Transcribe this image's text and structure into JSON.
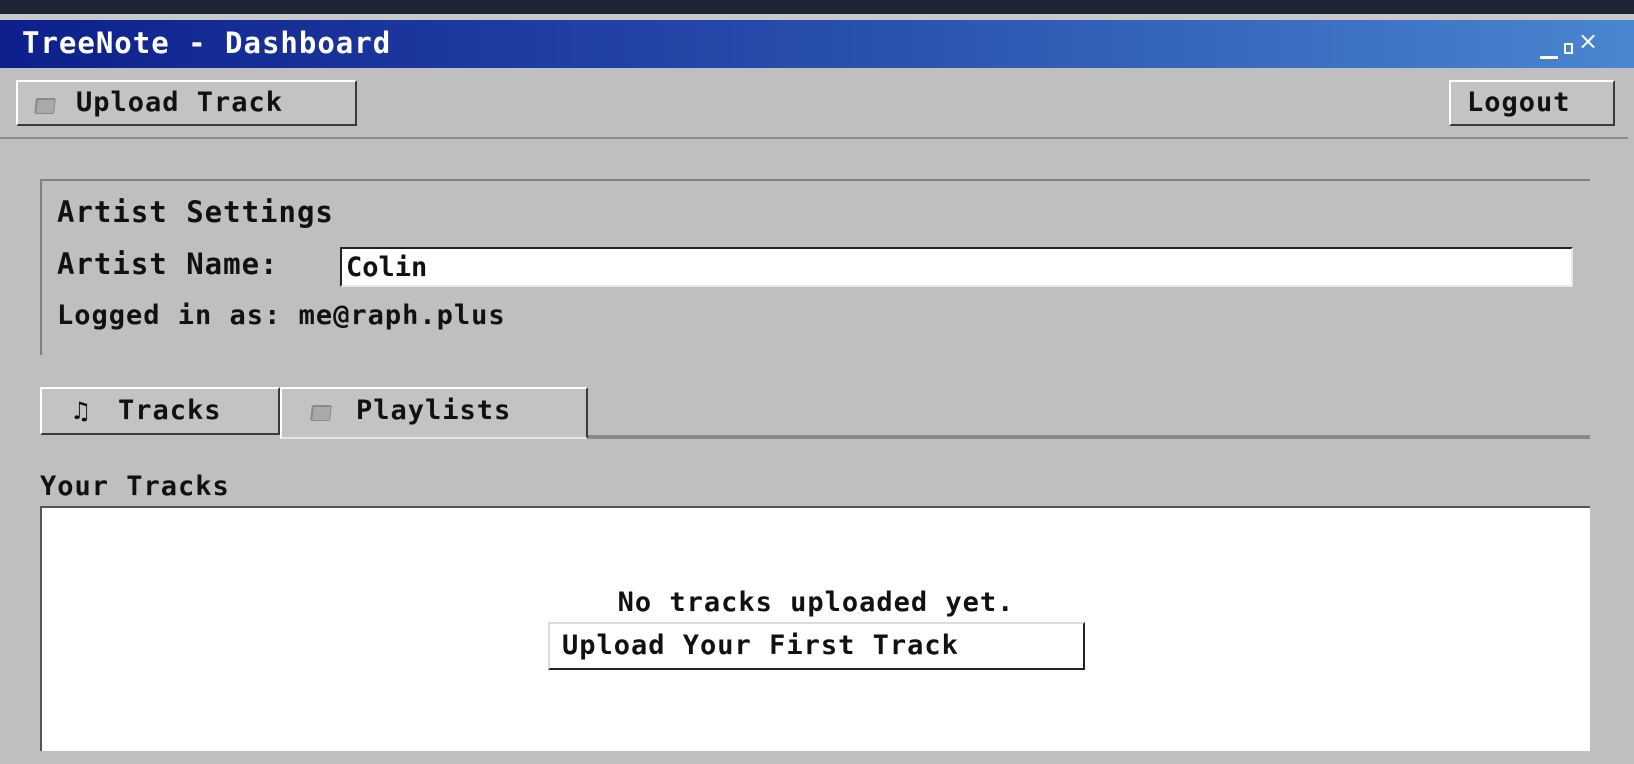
{
  "window": {
    "title": "TreeNote - Dashboard",
    "controls": {
      "close": "×"
    }
  },
  "toolbar": {
    "upload_label": "Upload Track",
    "upload_icon": "folder-icon",
    "logout_label": "Logout"
  },
  "settings": {
    "heading": "Artist Settings",
    "artist_name_label": "Artist Name:",
    "artist_name_value": "Colin",
    "logged_in_text": "Logged in as: me@raph.plus"
  },
  "tabs": [
    {
      "label": "Tracks",
      "icon": "music-note-icon",
      "glyph": "♫",
      "active": false
    },
    {
      "label": "Playlists",
      "icon": "folder-icon",
      "active": true
    }
  ],
  "tracks": {
    "section_label": "Your Tracks",
    "empty_message": "No tracks uploaded yet.",
    "upload_first_label": "Upload Your First Track"
  },
  "colors": {
    "titlebar_start": "#0d1f8c",
    "titlebar_end": "#4a86cf",
    "background": "#bfbfbf"
  }
}
